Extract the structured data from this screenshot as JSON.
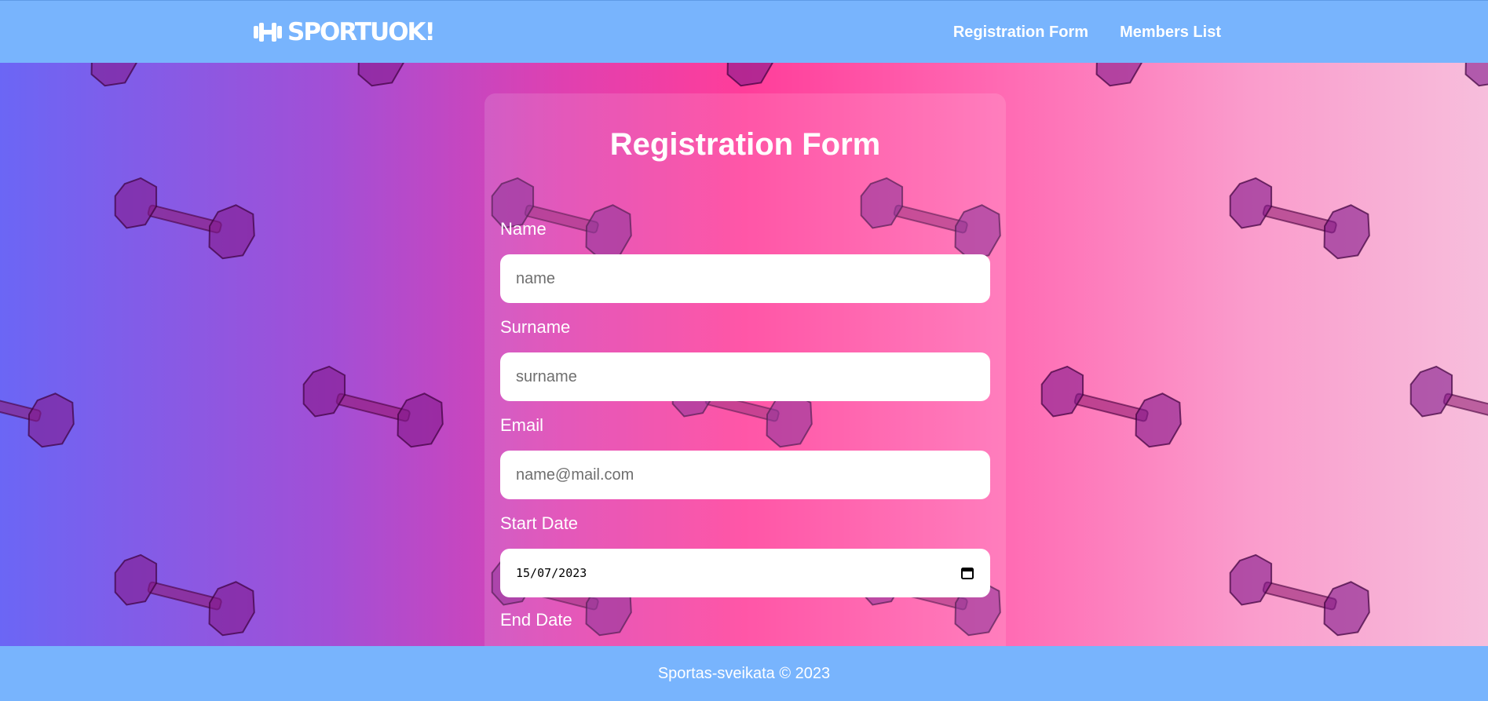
{
  "brand": {
    "logo_text": "SPORTUOK!",
    "logo_icon": "dumbbell-icon"
  },
  "nav": {
    "items": [
      {
        "label": "Registration Form"
      },
      {
        "label": "Members List"
      }
    ]
  },
  "form": {
    "title": "Registration Form",
    "fields": {
      "name": {
        "label": "Name",
        "placeholder": "name"
      },
      "surname": {
        "label": "Surname",
        "placeholder": "surname"
      },
      "email": {
        "label": "Email",
        "placeholder": "name@mail.com"
      },
      "start_date": {
        "label": "Start Date",
        "value": "15/07/2023",
        "icon": "calendar-icon"
      },
      "end_date": {
        "label": "End Date"
      }
    }
  },
  "footer": {
    "text": "Sportas-sveikata © 2023"
  },
  "colors": {
    "navbar": "#78b4fd",
    "footer": "#78b4fd",
    "gradient_left": "#6b66f5",
    "gradient_mid": "#ff3d9a",
    "gradient_right": "#f7bedc",
    "text": "#ffffff"
  },
  "background_pattern": "dumbbell-pattern"
}
